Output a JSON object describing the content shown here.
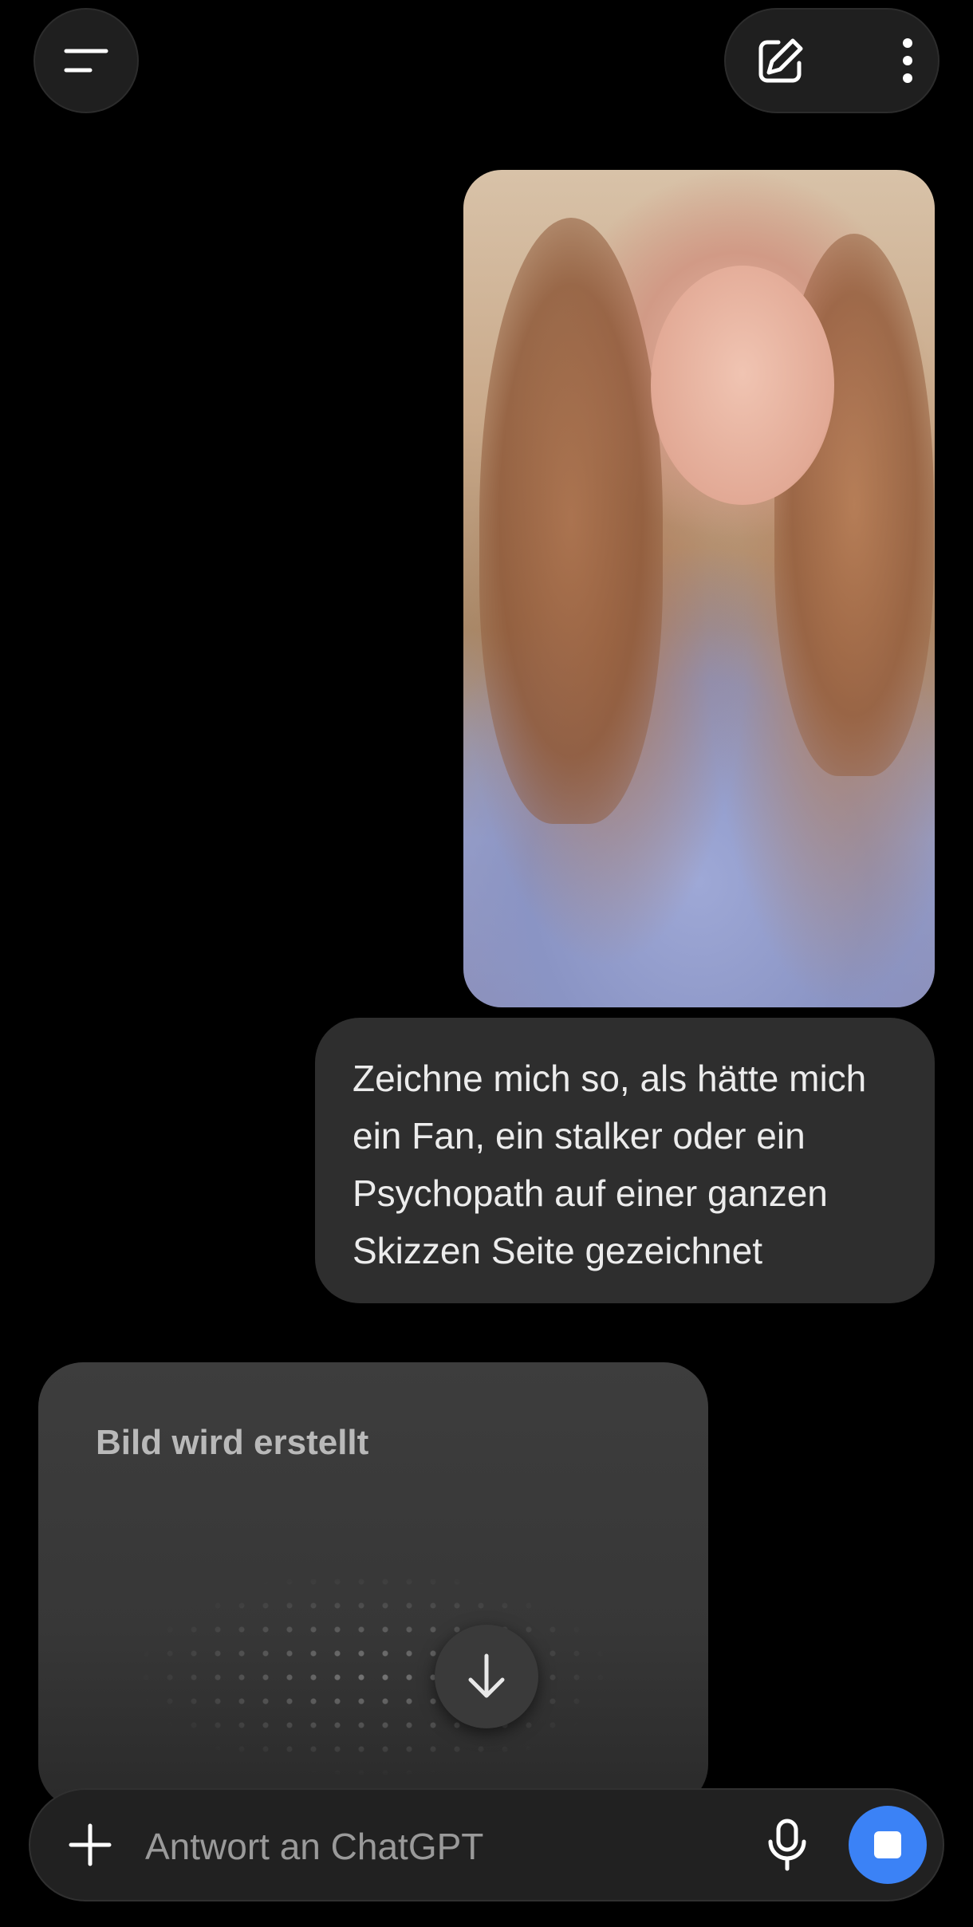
{
  "header": {
    "menu_icon": "menu-lines-icon",
    "new_chat_icon": "edit-icon",
    "more_icon": "more-vertical-icon"
  },
  "messages": {
    "user_photo_alt": "",
    "user_text": "Zeichne mich so, als hätte mich\nein Fan, ein stalker oder ein\nPsychopath auf einer ganzen\nSkizzen Seite gezeichnet"
  },
  "generation": {
    "status_text": "Bild wird erstellt"
  },
  "composer": {
    "placeholder": "Antwort an ChatGPT",
    "value": "",
    "plus_icon": "plus-icon",
    "mic_icon": "microphone-icon",
    "stop_icon": "stop-icon"
  },
  "colors": {
    "background": "#000000",
    "bubble": "#2e2e2e",
    "card": "#3d3d3d",
    "accent": "#3b82f6"
  }
}
